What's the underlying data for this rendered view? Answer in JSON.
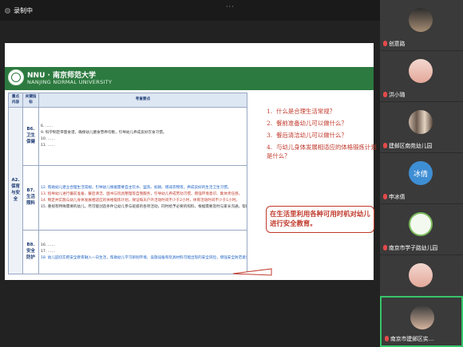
{
  "topbar": {
    "recording_label": "录制中",
    "more": "···"
  },
  "slide": {
    "university_cn": "NNU · 南京师范大学",
    "university_en": "NANJING NORMAL UNIVERSITY",
    "table": {
      "headers": [
        "重点内容",
        "关键指标",
        "考查要点"
      ],
      "section": "A2. 保育与安全",
      "groups": [
        {
          "indicator": "B6. 卫生保健",
          "rows": [
            "6. ……",
            "9. 科学制定带量食谱，确保幼儿膳食营养均衡，引导幼儿养成良好饮食习惯。",
            "10. ……",
            "11. ……"
          ]
        },
        {
          "indicator": "B7. 生活照料",
          "rows": [
            "12. 帮助幼儿建立合理生活常规，引导幼儿根据需要自主饮水、盥洗、如厕、增减衣物等，养成良好的生活卫生习惯。",
            "13. 指导幼儿进行餐前准备、餐后清洁、图书与玩具整理等自我服务，引导幼儿养成劳动习惯，增强环境意识、集体责任感。",
            "14. 制定并实施与幼儿身体发展相适应的体格锻炼计划，保证每天户外活动时间不少于2小时，体育活动时间不少于1小时。",
            "15. 重视有特殊需要的幼儿，尽可能创造条件让幼儿参与班级的各项活动，同时给予必要的照料，根据需要及时与家长沟通，帮助幼儿获得专业的康复指导与治疗"
          ]
        },
        {
          "indicator": "B8. 安全防护",
          "rows": [
            "16. ……",
            "17. ……",
            "18. 幼儿园切实把安全教育融入一日生活，帮助幼儿学习辨别环境、设施设备和玩具材料可能出现的安全风险，增强安全防范意识，提高自我保护能力。"
          ]
        }
      ]
    },
    "questions": [
      {
        "num": "1.",
        "text": "什么是合理生活常规？"
      },
      {
        "num": "2.",
        "text": "餐前准备幼儿可以做什么？"
      },
      {
        "num": "3.",
        "text": "餐后清洁幼儿可以做什么？"
      },
      {
        "num": "4.",
        "text": "与幼儿身体发展相适应的体格锻炼计划是什么？"
      }
    ],
    "callout": "在生活里利用各种可用时机对幼儿进行安全教育。"
  },
  "participants": [
    {
      "name": "创意路",
      "avatar": "photo-dark"
    },
    {
      "name": "洪小璐",
      "avatar": "girl"
    },
    {
      "name": "建邺区南苑幼儿园",
      "avatar": "photo-group"
    },
    {
      "name": "申冰倩",
      "avatar": "blue",
      "initials": "冰倩"
    },
    {
      "name": "南京市学子路幼儿园",
      "avatar": "logo-green"
    },
    {
      "name": "尹英",
      "avatar": "girl"
    },
    {
      "name": "南京市建邺区实…",
      "avatar": "child"
    }
  ],
  "colors": {
    "accent_green": "#2c7a3f",
    "question_red": "#c0392b",
    "active_border": "#37c46a"
  }
}
